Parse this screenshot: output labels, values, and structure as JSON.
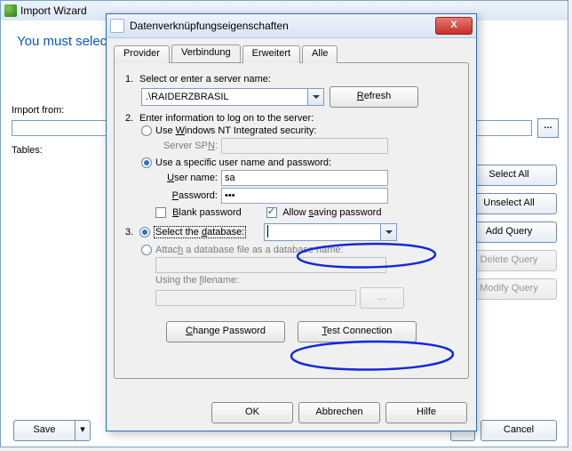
{
  "back": {
    "title": "Import Wizard",
    "blue_msg": "You must selec",
    "import_from_label": "Import from:",
    "import_from_value": "",
    "tables_label": "Tables:",
    "right_buttons": {
      "select_all": "Select All",
      "unselect_all": "Unselect All",
      "add_query": "Add Query",
      "delete_query": "Delete Query",
      "modify_query": "Modify Query"
    },
    "bottom": {
      "save": "Save",
      "next": ">>",
      "cancel": "Cancel"
    }
  },
  "dlg": {
    "title": "Datenverknüpfungseigenschaften",
    "close": "X",
    "tabs": {
      "provider": "Provider",
      "verbindung": "Verbindung",
      "erweitert": "Erweitert",
      "alle": "Alle"
    },
    "step1": {
      "num": "1.",
      "label": "Select or enter a server name:",
      "server": ".\\RAIDERZBRASIL",
      "refresh": "Refresh"
    },
    "step2": {
      "num": "2.",
      "label": "Enter information to log on to the server:",
      "use_nt": "Use Windows NT Integrated security:",
      "server_spn": "Server SPN:",
      "use_specific": "Use a specific user name and password:",
      "username_label": "User name:",
      "username_value": "sa",
      "password_label": "Password:",
      "password_value": "•••",
      "blank_pw": "Blank password",
      "allow_save": "Allow saving password"
    },
    "step3": {
      "num": "3.",
      "select_db": "Select the database:",
      "db_value": "",
      "attach": "Attach a database file as a database name:",
      "using_file": "Using the filename:",
      "browse": "..."
    },
    "actions": {
      "change_pw": "Change Password",
      "test_conn": "Test Connection"
    },
    "buttons": {
      "ok": "OK",
      "cancel": "Abbrechen",
      "help": "Hilfe"
    }
  }
}
